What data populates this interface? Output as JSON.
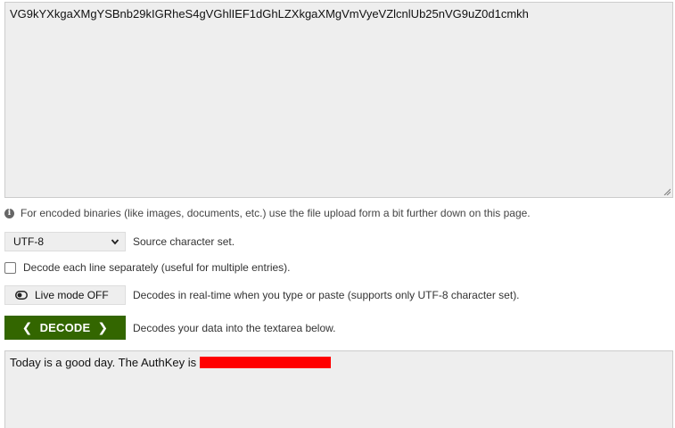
{
  "input": {
    "value": "VG9kYXkgaXMgYSBnb29kIGRheS4gVGhlIEF1dGhLZXkgaXMgVmVyeVZlcnlUb25nVG9uZ0d1cmkh"
  },
  "info": {
    "text": "For encoded binaries (like images, documents, etc.) use the file upload form a bit further down on this page."
  },
  "charset": {
    "selected": "UTF-8",
    "label": "Source character set."
  },
  "separate_lines": {
    "label": "Decode each line separately (useful for multiple entries).",
    "checked": false
  },
  "live_mode": {
    "button_label": "Live mode OFF",
    "description": "Decodes in real-time when you type or paste (supports only UTF-8 character set)."
  },
  "decode": {
    "button_label": "DECODE",
    "description": "Decodes your data into the textarea below.",
    "color": "#336600"
  },
  "output": {
    "value": "Today is a good day. The AuthKey is ",
    "redaction_color": "#ff0000"
  }
}
